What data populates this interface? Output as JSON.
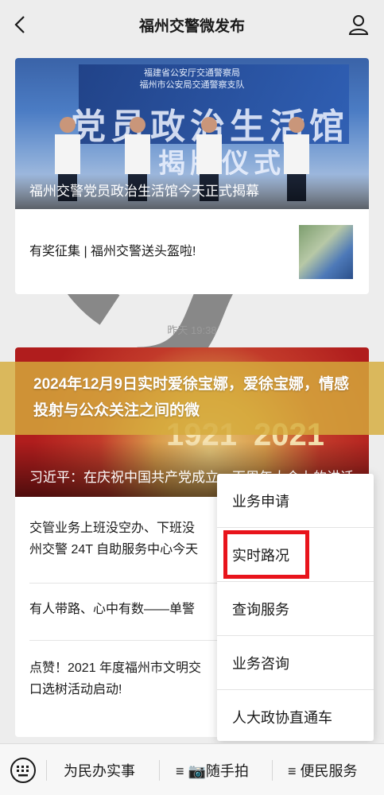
{
  "header": {
    "title": "福州交警微发布",
    "back_icon": "chevron-left-icon",
    "ear_icon": "ear-icon",
    "profile_icon": "person-icon"
  },
  "feed": {
    "article1": {
      "hero_title": "福州交警党员政治生活馆今天正式揭幕",
      "hero_sub_lines": [
        "福建省公安厅交通警察局",
        "福州市公安局交通警察支队"
      ],
      "hero_big_text": "党员政治生活馆",
      "hero_big_text2": "揭牌仪式"
    },
    "article2": {
      "title": "有奖征集 | 福州交警送头盔啦!"
    },
    "timestamp": "昨天 19:38",
    "article3": {
      "hero_numbers": [
        "1921",
        "2021"
      ],
      "hero_title": "习近平：在庆祝中国共产党成立一百周年大会上的讲话"
    },
    "article4": {
      "title_line1": "交管业务上班没空办、下班没",
      "title_line2": "州交警 24T 自助服务中心今天"
    },
    "article5": {
      "title": "有人带路、心中有数——单警"
    },
    "article6": {
      "title_line1": "点赞！2021 年度福州市文明交",
      "title_line2": "口选树活动启动!"
    }
  },
  "overlay_banner": {
    "text": "2024年12月9日实时爱徐宝娜，爱徐宝娜，情感投射与公众关注之间的微"
  },
  "popup_menu": {
    "items": [
      "业务申请",
      "实时路况",
      "查询服务",
      "业务咨询",
      "人大政协直通车"
    ],
    "highlighted_item": "实时路况",
    "highlight_color": "#e8141b"
  },
  "bottom_bar": {
    "keyboard_icon": "keyboard-icon",
    "tabs": [
      "为民办实事",
      "≡ 📷随手拍",
      "≡ 便民服务"
    ]
  }
}
